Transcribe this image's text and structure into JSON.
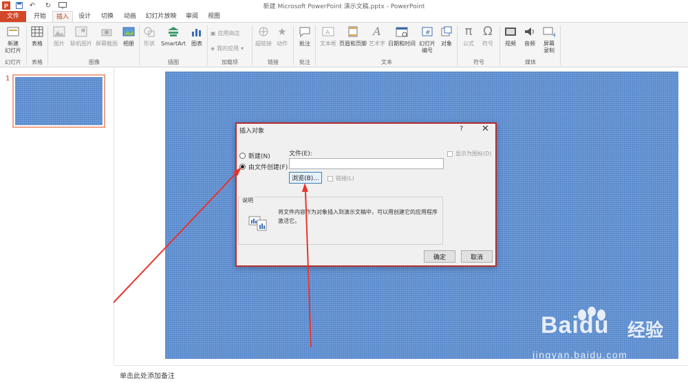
{
  "app_title": "新建 Microsoft PowerPoint 演示文稿.pptx - PowerPoint",
  "quick_access": [
    "save-icon",
    "undo-icon",
    "redo-icon",
    "present-icon"
  ],
  "tabs": [
    {
      "label": "文件",
      "file": true
    },
    {
      "label": "开始"
    },
    {
      "label": "插入",
      "active": true
    },
    {
      "label": "设计"
    },
    {
      "label": "切换"
    },
    {
      "label": "动画"
    },
    {
      "label": "幻灯片放映"
    },
    {
      "label": "审阅"
    },
    {
      "label": "视图"
    }
  ],
  "ribbon": {
    "groups": {
      "slides": "幻灯片",
      "tables": "表格",
      "images": "图像",
      "illustrations": "插图",
      "addins": "加载项",
      "links": "链接",
      "comments": "批注",
      "text": "文本",
      "symbols": "符号",
      "media": "媒体"
    },
    "buttons": {
      "new_slide": "新建\n幻灯片",
      "table": "表格",
      "picture": "图片",
      "online_picture": "联机图片",
      "screenshot": "屏幕截图",
      "album": "相册",
      "shapes": "形状",
      "smartart": "SmartArt",
      "chart": "图表",
      "app_store": "应用商店",
      "my_apps": "我的应用",
      "hyperlink": "超链接",
      "action": "动作",
      "comment": "批注",
      "textbox": "文本框",
      "header_footer": "页眉和页脚",
      "wordart": "艺术字",
      "datetime": "日期和时间",
      "slide_number": "幻灯片\n编号",
      "object": "对象",
      "equation": "公式",
      "symbol": "符号",
      "video": "视频",
      "audio": "音频",
      "screen_recording": "屏幕\n录制"
    }
  },
  "thumbnail": {
    "number": "1"
  },
  "notes_placeholder": "单击此处添加备注",
  "dialog": {
    "title": "插入对象",
    "help": "?",
    "close": "✕",
    "radio_new": "新建(N)",
    "radio_from_file": "由文件创建(F)",
    "selected": "from_file",
    "file_label": "文件(E):",
    "file_value": "",
    "browse_label": "浏览(B)...",
    "link_label": "链接(L)",
    "show_as_icon_label": "显示为图标(D)",
    "desc_title": "说明",
    "desc_text": "将文件内容作为对象插入到演示文稿中，可以用创建它的应用程序激活它。",
    "ok_label": "确定",
    "cancel_label": "取消"
  },
  "watermark": {
    "brand": "Bai",
    "brand2": "du",
    "cn": "经验",
    "url": "jingyan.baidu.com"
  },
  "colors": {
    "accent": "#d24726",
    "slide_bg": "#6f9bd6",
    "arrow": "#e8332c",
    "dialog_border": "#b32e2e"
  }
}
